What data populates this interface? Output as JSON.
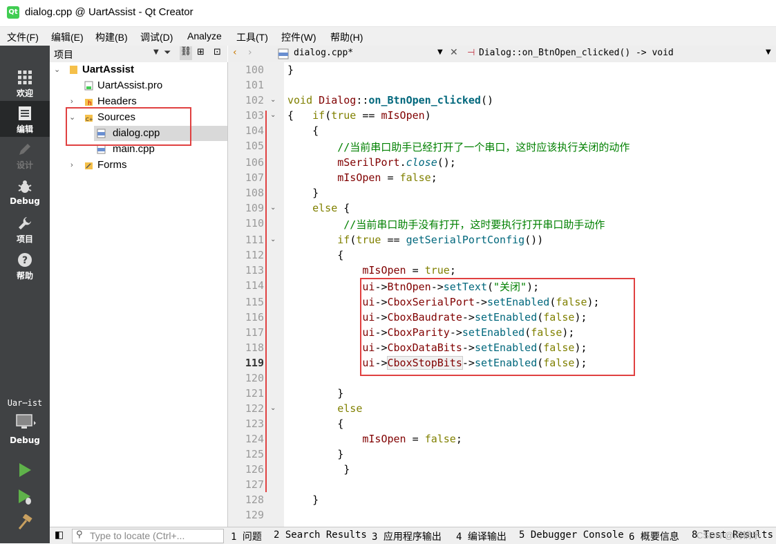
{
  "window": {
    "title": "dialog.cpp @ UartAssist - Qt Creator",
    "logo_text": "Qt"
  },
  "menu": [
    "文件(F)",
    "编辑(E)",
    "构建(B)",
    "调试(D)",
    "Analyze",
    "工具(T)",
    "控件(W)",
    "帮助(H)"
  ],
  "modes": [
    {
      "label": "欢迎",
      "icon": "grid-icon"
    },
    {
      "label": "编辑",
      "icon": "edit-doc-icon"
    },
    {
      "label": "设计",
      "icon": "pencil-icon"
    },
    {
      "label": "Debug",
      "icon": "bug-icon"
    },
    {
      "label": "项目",
      "icon": "wrench-icon"
    },
    {
      "label": "帮助",
      "icon": "help-icon"
    }
  ],
  "kit": {
    "project": "Uar⋯ist",
    "mode": "Debug"
  },
  "project_pane": {
    "title": "项目"
  },
  "tree": {
    "root": "UartAssist",
    "pro": "UartAssist.pro",
    "headers": "Headers",
    "sources": "Sources",
    "dialog": "dialog.cpp",
    "main": "main.cpp",
    "forms": "Forms"
  },
  "editor": {
    "file_tab": "dialog.cpp*",
    "function": "Dialog::on_BtnOpen_clicked() -> void",
    "line_numbers": [
      "100",
      "101",
      "102",
      "103",
      "104",
      "105",
      "106",
      "107",
      "108",
      "109",
      "110",
      "111",
      "112",
      "113",
      "114",
      "115",
      "116",
      "117",
      "118",
      "119",
      "120",
      "121",
      "122",
      "123",
      "124",
      "125",
      "126",
      "127",
      "128",
      "129"
    ],
    "current_line": "119"
  },
  "status": {
    "locator_placeholder": "Type to locate (Ctrl+...",
    "tabs": [
      "1 问题",
      "2 Search Results",
      "3 应用程序输出",
      "4 编译输出",
      "5 Debugger Console",
      "6 概要信息",
      "8 Test Results"
    ],
    "watermark": "CSDN @闫锅乐"
  }
}
